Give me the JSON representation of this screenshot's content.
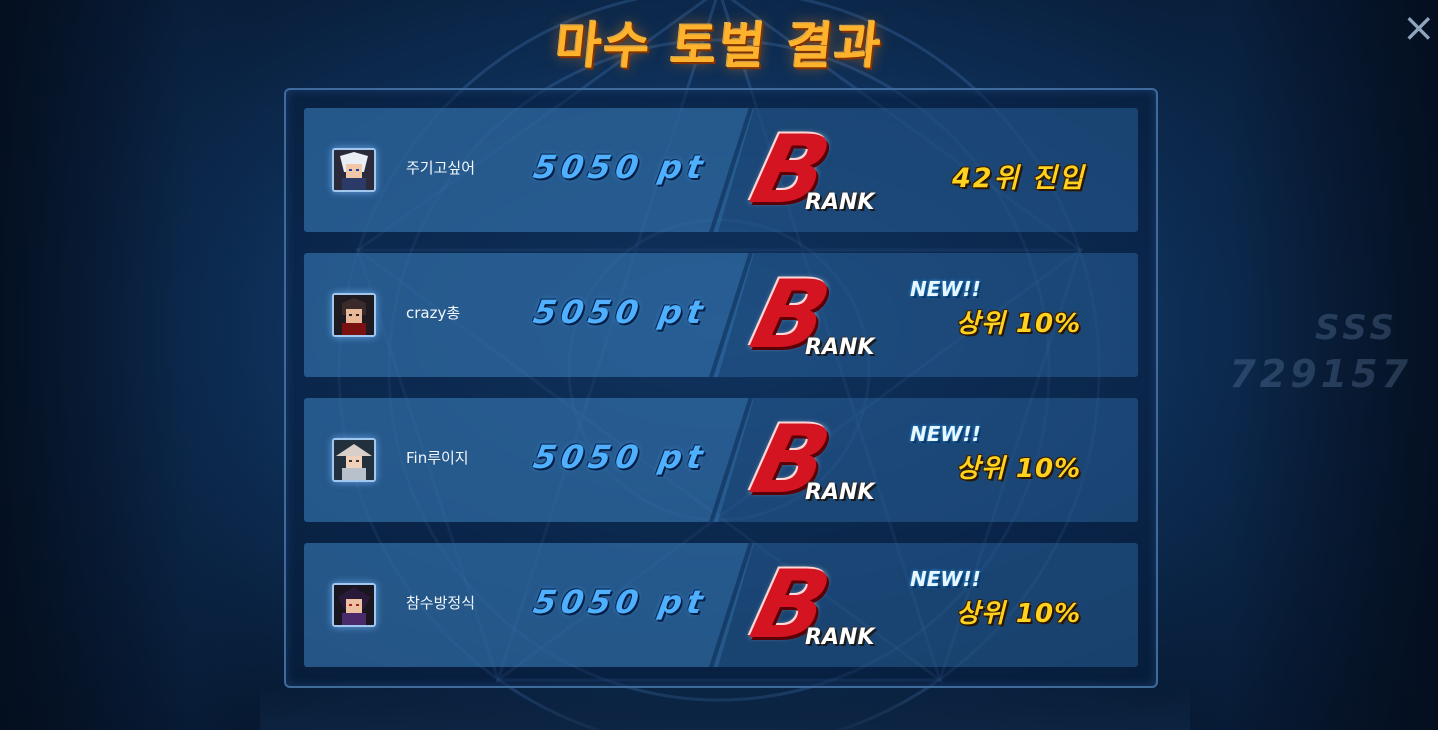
{
  "title": "마수 토벌 결과",
  "background": {
    "sss_text": "SSS",
    "score_text": "729157"
  },
  "results": [
    {
      "name": "주기고싶어",
      "avatar_icon": "character-avatar-icon",
      "points": "5050 pt",
      "rank_letter": "B",
      "rank_word": "RANK",
      "entry_text": "42위 진입",
      "new_badge": "",
      "percent_text": ""
    },
    {
      "name": "crazy총",
      "avatar_icon": "character-avatar-icon",
      "points": "5050 pt",
      "rank_letter": "B",
      "rank_word": "RANK",
      "entry_text": "",
      "new_badge": "NEW!!",
      "percent_text": "상위 10%"
    },
    {
      "name": "Fin루이지",
      "avatar_icon": "character-avatar-icon",
      "points": "5050 pt",
      "rank_letter": "B",
      "rank_word": "RANK",
      "entry_text": "",
      "new_badge": "NEW!!",
      "percent_text": "상위 10%"
    },
    {
      "name": "참수방정식",
      "avatar_icon": "character-avatar-icon",
      "points": "5050 pt",
      "rank_letter": "B",
      "rank_word": "RANK",
      "entry_text": "",
      "new_badge": "NEW!!",
      "percent_text": "상위 10%"
    }
  ],
  "colors": {
    "title": "#ffb22b",
    "points": "#4fb0ff",
    "rank_letter": "#d41521",
    "highlight_text": "#ffd21f"
  },
  "close_icon": "close-icon"
}
